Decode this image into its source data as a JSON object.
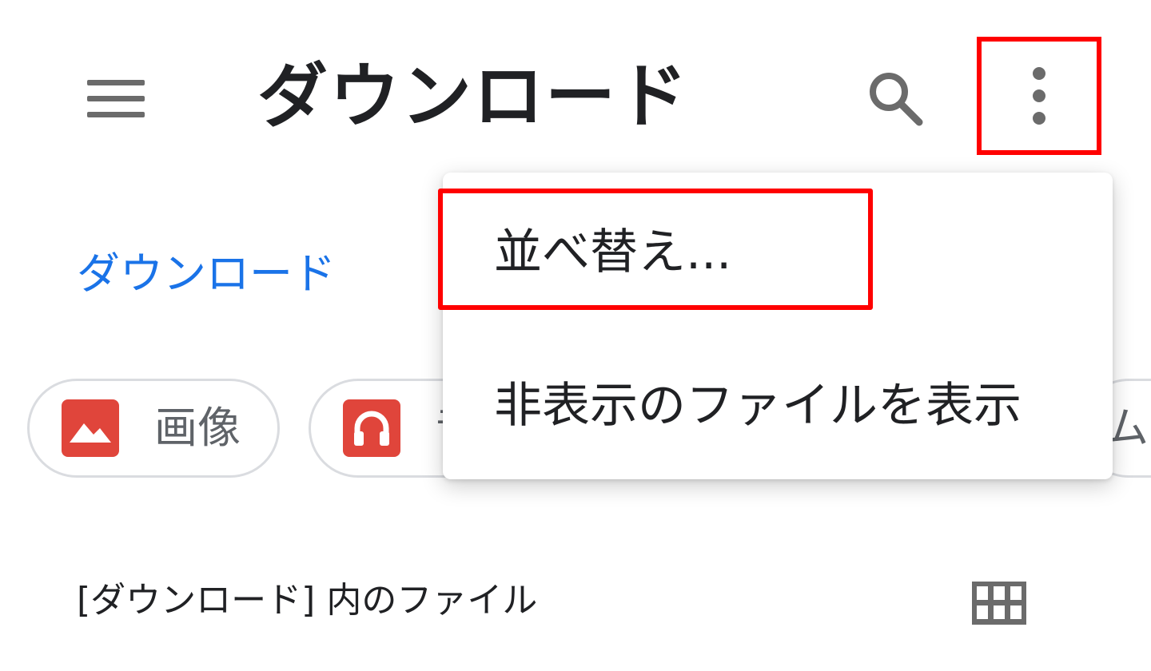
{
  "appbar": {
    "menu_icon": "hamburger-menu-icon",
    "title": "ダウンロード",
    "search_icon": "search-icon",
    "more_icon": "more-vert-icon"
  },
  "breadcrumb": {
    "current": "ダウンロード"
  },
  "chips": [
    {
      "label": "画像",
      "icon": "image-icon"
    },
    {
      "label": "音",
      "icon": "headphones-icon"
    },
    {
      "label": "ム",
      "icon": ""
    }
  ],
  "section": {
    "title": "[ダウンロード] 内のファイル",
    "view_icon": "grid-view-icon"
  },
  "overflow_menu": {
    "items": [
      {
        "label": "並べ替え..."
      },
      {
        "label": "非表示のファイルを表示"
      }
    ]
  },
  "colors": {
    "accent_blue": "#1a73e8",
    "highlight_red": "#ff0000",
    "chip_icon_red": "#e0453b",
    "icon_gray": "#6b6b6b"
  }
}
